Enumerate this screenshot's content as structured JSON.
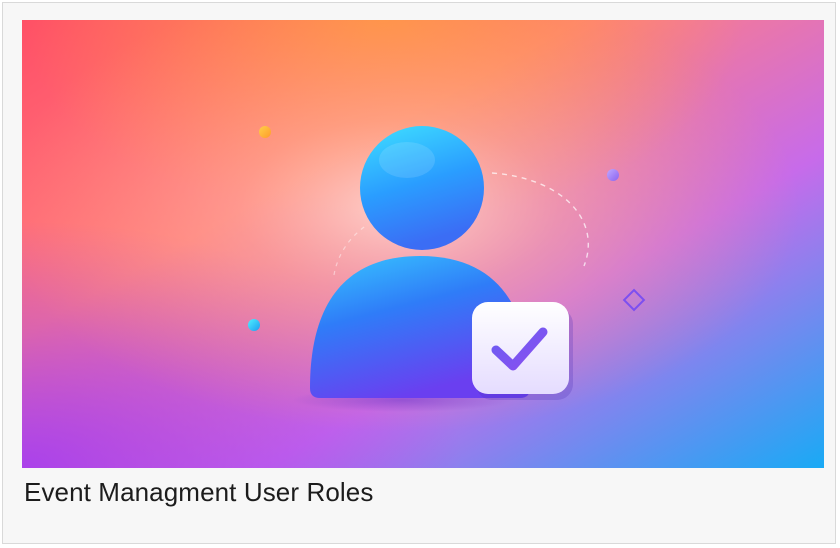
{
  "card": {
    "title": "Event Managment User Roles"
  },
  "illustration": {
    "icon": "user-check-icon",
    "accent_colors": [
      "#ff5a5f",
      "#ff9a4a",
      "#b84df0",
      "#2f9bff",
      "#18b4f5"
    ]
  }
}
